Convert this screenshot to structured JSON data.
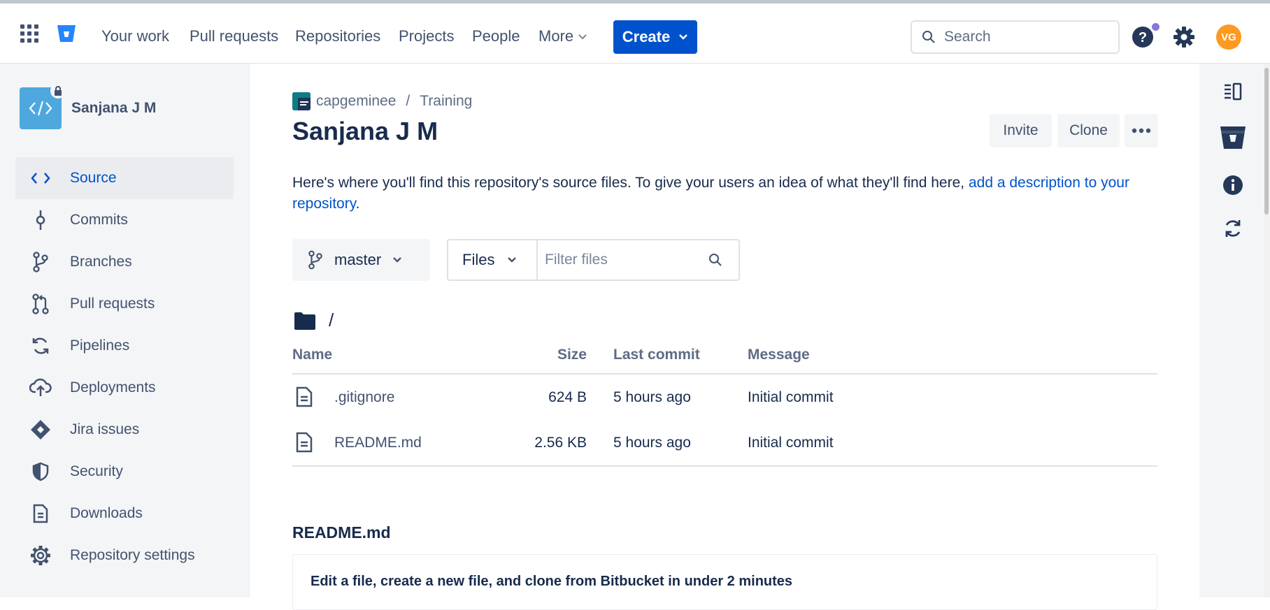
{
  "nav": {
    "items": [
      "Your work",
      "Pull requests",
      "Repositories",
      "Projects",
      "People"
    ],
    "more_label": "More",
    "create_label": "Create",
    "search_placeholder": "Search",
    "avatar_initials": "VG"
  },
  "sidebar": {
    "repo_name": "Sanjana J M",
    "items": [
      {
        "label": "Source",
        "icon": "code-icon"
      },
      {
        "label": "Commits",
        "icon": "commit-icon"
      },
      {
        "label": "Branches",
        "icon": "branch-icon"
      },
      {
        "label": "Pull requests",
        "icon": "pull-request-icon"
      },
      {
        "label": "Pipelines",
        "icon": "pipelines-icon"
      },
      {
        "label": "Deployments",
        "icon": "cloud-upload-icon"
      },
      {
        "label": "Jira issues",
        "icon": "jira-icon"
      },
      {
        "label": "Security",
        "icon": "shield-icon"
      },
      {
        "label": "Downloads",
        "icon": "file-icon"
      },
      {
        "label": "Repository settings",
        "icon": "gear-icon"
      }
    ]
  },
  "breadcrumb": {
    "workspace": "capgeminee",
    "separator": "/",
    "project": "Training"
  },
  "page": {
    "title": "Sanjana J M",
    "invite_label": "Invite",
    "clone_label": "Clone",
    "description_text": "Here's where you'll find this repository's source files. To give your users an idea of what they'll find here, ",
    "description_link": "add a description to your repository",
    "description_end": "."
  },
  "toolbar": {
    "branch": "master",
    "files_label": "Files",
    "filter_placeholder": "Filter files"
  },
  "path": "/",
  "table": {
    "headers": {
      "name": "Name",
      "size": "Size",
      "last_commit": "Last commit",
      "message": "Message"
    },
    "rows": [
      {
        "name": ".gitignore",
        "size": "624 B",
        "last_commit": "5 hours ago",
        "message": "Initial commit"
      },
      {
        "name": "README.md",
        "size": "2.56 KB",
        "last_commit": "5 hours ago",
        "message": "Initial commit"
      }
    ]
  },
  "readme": {
    "title": "README.md",
    "heading": "Edit a file, create a new file, and clone from Bitbucket in under 2 minutes"
  },
  "colors": {
    "brand": "#0052cc",
    "avatar": "#ff991f",
    "notification": "#8777d9"
  }
}
